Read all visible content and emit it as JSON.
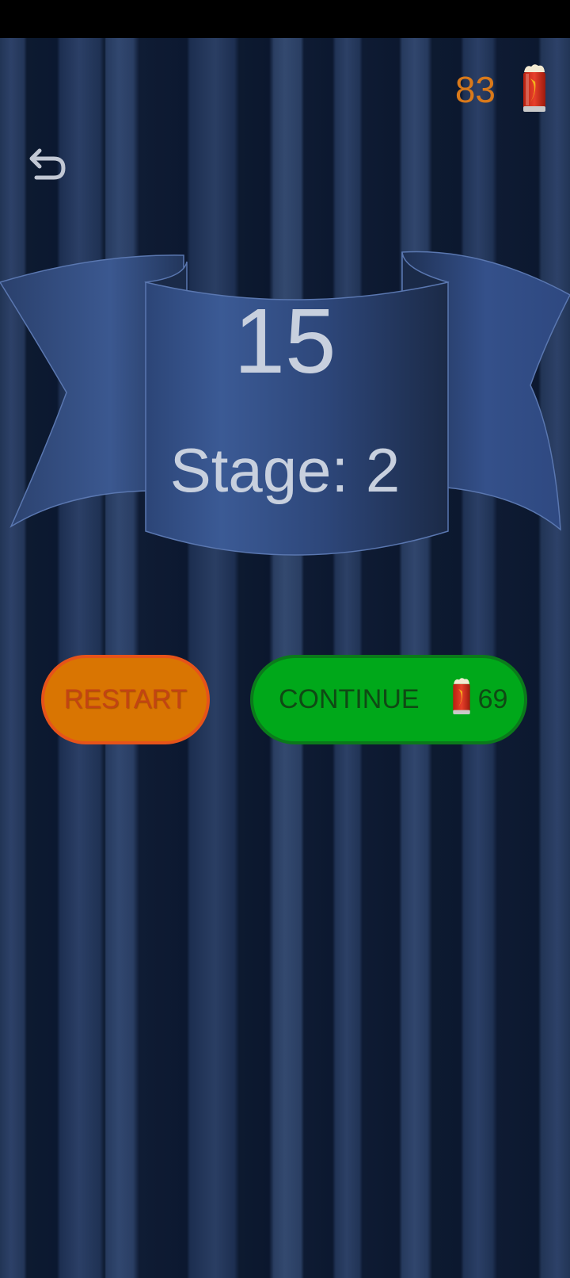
{
  "top_bar": {
    "coin_count": "83",
    "coin_icon": "beer-can-icon"
  },
  "navigation": {
    "back_icon": "undo-arrow-icon"
  },
  "result": {
    "score": "15",
    "stage_label": "Stage: 2"
  },
  "buttons": {
    "restart_label": "RESTART",
    "continue_label": "CONTINUE",
    "continue_cost": "69",
    "continue_cost_icon": "beer-can-icon"
  },
  "colors": {
    "background": "#0d1a30",
    "banner": "#34548c",
    "coin_text": "#d9791a",
    "restart_fill": "#d97502",
    "restart_text": "#c24413",
    "continue_fill": "#00a81a",
    "continue_text": "#0f4a14",
    "score_text": "#c8d0de"
  }
}
